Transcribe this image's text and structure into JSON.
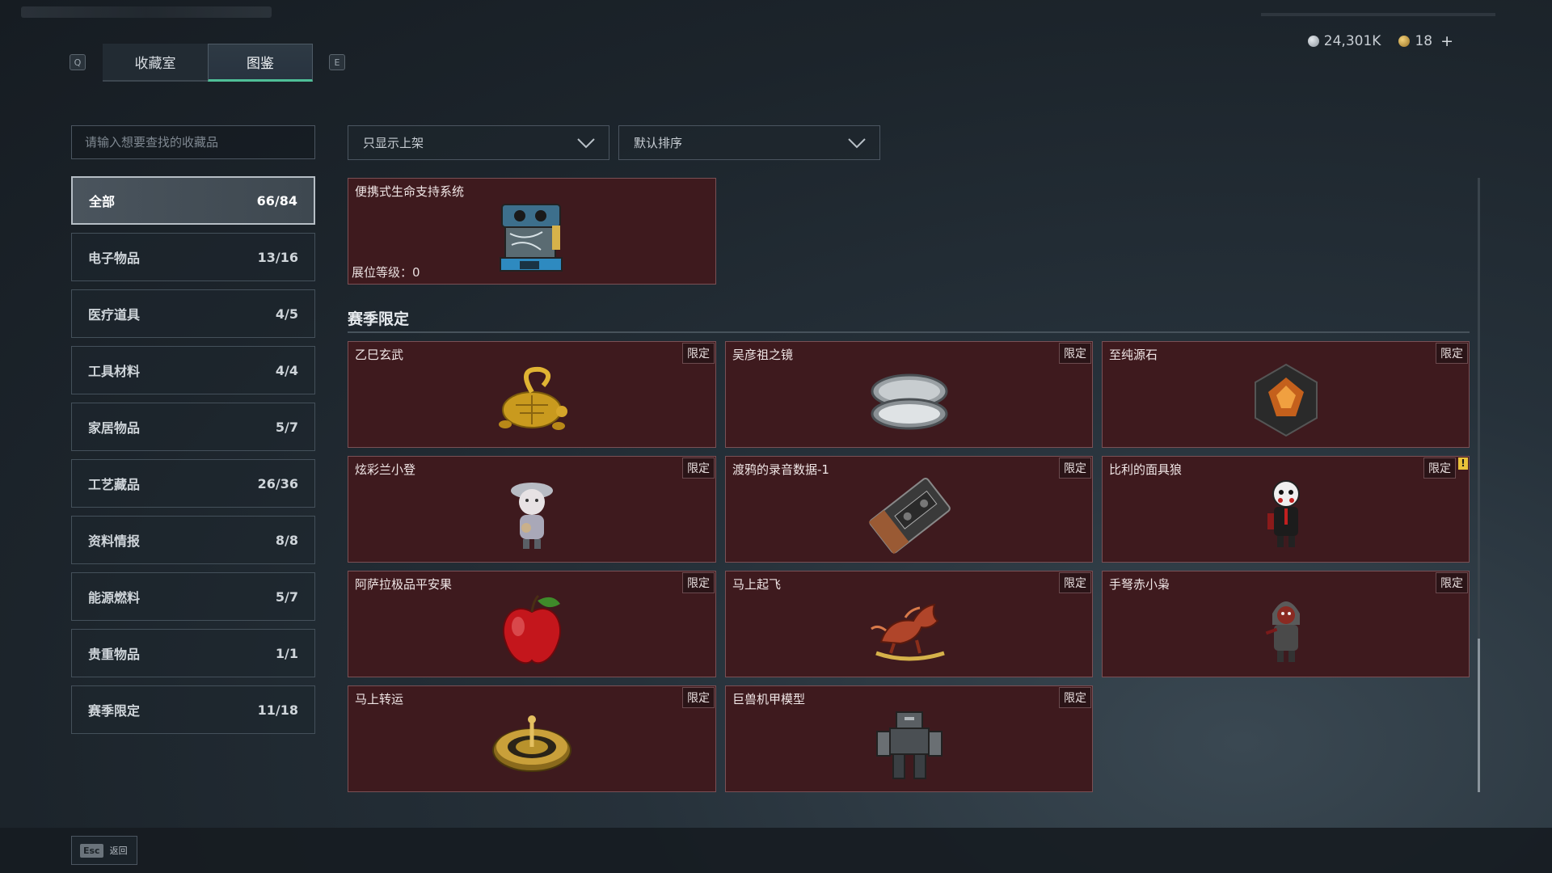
{
  "tabs": {
    "key_left": "Q",
    "key_right": "E",
    "items": [
      {
        "label": "收藏室"
      },
      {
        "label": "图鉴"
      }
    ]
  },
  "currency": {
    "silver": "24,301K",
    "gold": "18",
    "plus": "+"
  },
  "search": {
    "placeholder": "请输入想要查找的收藏品"
  },
  "categories": [
    {
      "name": "全部",
      "count": "66/84"
    },
    {
      "name": "电子物品",
      "count": "13/16"
    },
    {
      "name": "医疗道具",
      "count": "4/5"
    },
    {
      "name": "工具材料",
      "count": "4/4"
    },
    {
      "name": "家居物品",
      "count": "5/7"
    },
    {
      "name": "工艺藏品",
      "count": "26/36"
    },
    {
      "name": "资料情报",
      "count": "8/8"
    },
    {
      "name": "能源燃料",
      "count": "5/7"
    },
    {
      "name": "贵重物品",
      "count": "1/1"
    },
    {
      "name": "赛季限定",
      "count": "11/18"
    }
  ],
  "filters": {
    "display": "只显示上架",
    "sort": "默认排序"
  },
  "featured": {
    "title": "便携式生命支持系统",
    "level": "展位等级：0"
  },
  "section": {
    "title": "赛季限定"
  },
  "limited_label": "限定",
  "limited_alt_label": "限定",
  "warn_mark": "!",
  "items": [
    {
      "title": "乙巳玄武"
    },
    {
      "title": "吴彦祖之镜"
    },
    {
      "title": "至纯源石"
    },
    {
      "title": "炫彩兰小登"
    },
    {
      "title": "渡鸦的录音数据-1"
    },
    {
      "title": "比利的面具狼"
    },
    {
      "title": "阿萨拉极品平安果"
    },
    {
      "title": "马上起飞"
    },
    {
      "title": "手弩赤小枭"
    },
    {
      "title": "马上转运"
    },
    {
      "title": "巨兽机甲模型"
    }
  ],
  "bottom": {
    "esc_key": "Esc",
    "esc_label": "返回"
  },
  "colors": {
    "accent": "#4fbf97",
    "card_bg": "#3e1a1e",
    "card_border": "#7a5055",
    "warn": "#e9c23a"
  }
}
